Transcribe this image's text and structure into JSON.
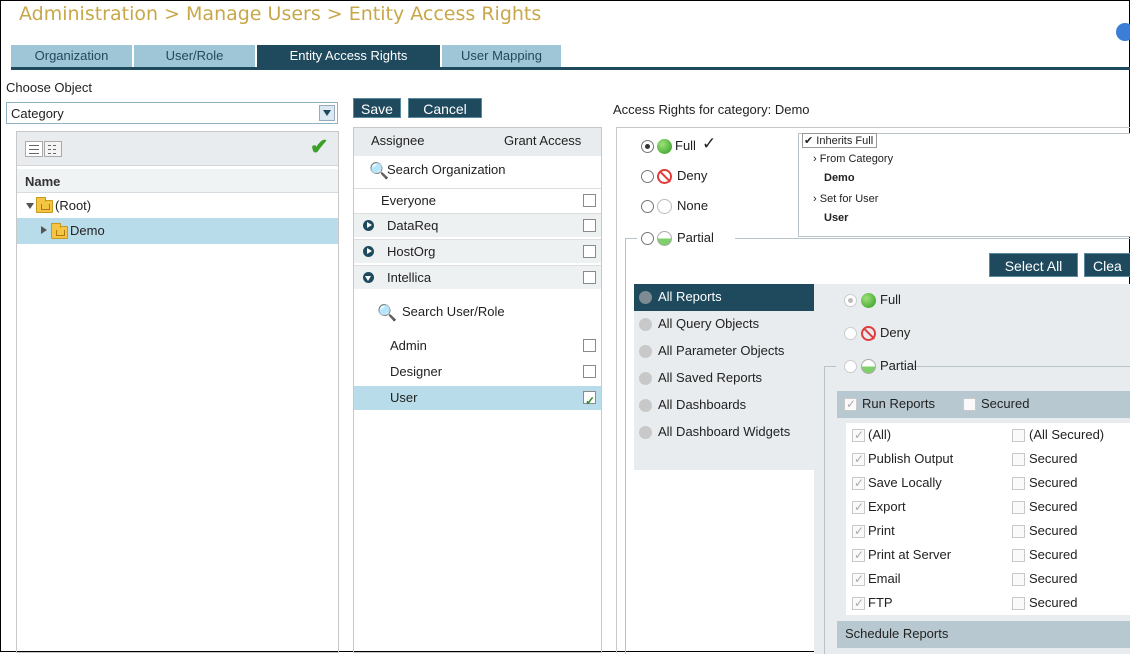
{
  "breadcrumb": "Administration > Manage Users > Entity Access Rights",
  "tabs": [
    {
      "label": "Organization"
    },
    {
      "label": "User/Role"
    },
    {
      "label": "Entity Access Rights"
    },
    {
      "label": "User Mapping"
    }
  ],
  "left": {
    "choose_object_label": "Choose Object",
    "select_value": "Category",
    "name_header": "Name",
    "tree": [
      {
        "label": "(Root)"
      },
      {
        "label": "Demo"
      }
    ]
  },
  "middle": {
    "save": "Save",
    "cancel": "Cancel",
    "assignee_header": "Assignee",
    "grant_header": "Grant Access",
    "search_org": "Search Organization",
    "search_user": "Search User/Role",
    "orgs": [
      {
        "label": "Everyone",
        "checked": false
      },
      {
        "label": "DataReq",
        "checked": false
      },
      {
        "label": "HostOrg",
        "checked": false
      },
      {
        "label": "Intellica",
        "checked": false
      }
    ],
    "users": [
      {
        "label": "Admin",
        "checked": false
      },
      {
        "label": "Designer",
        "checked": false
      },
      {
        "label": "User",
        "checked": true
      }
    ]
  },
  "right": {
    "heading": "Access Rights for category: Demo",
    "options": {
      "full": "Full",
      "deny": "Deny",
      "none": "None",
      "partial": "Partial"
    },
    "selected_option": "Full",
    "inherit": {
      "title": "Inherits Full",
      "from_label": "From Category",
      "from_value": "Demo",
      "set_label": "Set for User",
      "set_value": "User"
    },
    "select_all": "Select All",
    "clear": "Clea",
    "report_types": [
      "All Reports",
      "All Query Objects",
      "All Parameter Objects",
      "All Saved Reports",
      "All Dashboards",
      "All Dashboard Widgets"
    ],
    "sub_options": {
      "full": "Full",
      "deny": "Deny",
      "partial": "Partial"
    },
    "run_reports": "Run Reports",
    "secured": "Secured",
    "permissions": [
      {
        "label": "(All)",
        "secured": "(All Secured)"
      },
      {
        "label": "Publish Output",
        "secured": "Secured"
      },
      {
        "label": "Save Locally",
        "secured": "Secured"
      },
      {
        "label": "Export",
        "secured": "Secured"
      },
      {
        "label": "Print",
        "secured": "Secured"
      },
      {
        "label": "Print at Server",
        "secured": "Secured"
      },
      {
        "label": "Email",
        "secured": "Secured"
      },
      {
        "label": "FTP",
        "secured": "Secured"
      }
    ],
    "schedule_reports": "Schedule Reports"
  },
  "colors": {
    "accent": "#1f4a5e",
    "tab": "#9fc6d6",
    "title": "#c8a74a",
    "selected_row": "#b9dcea"
  }
}
